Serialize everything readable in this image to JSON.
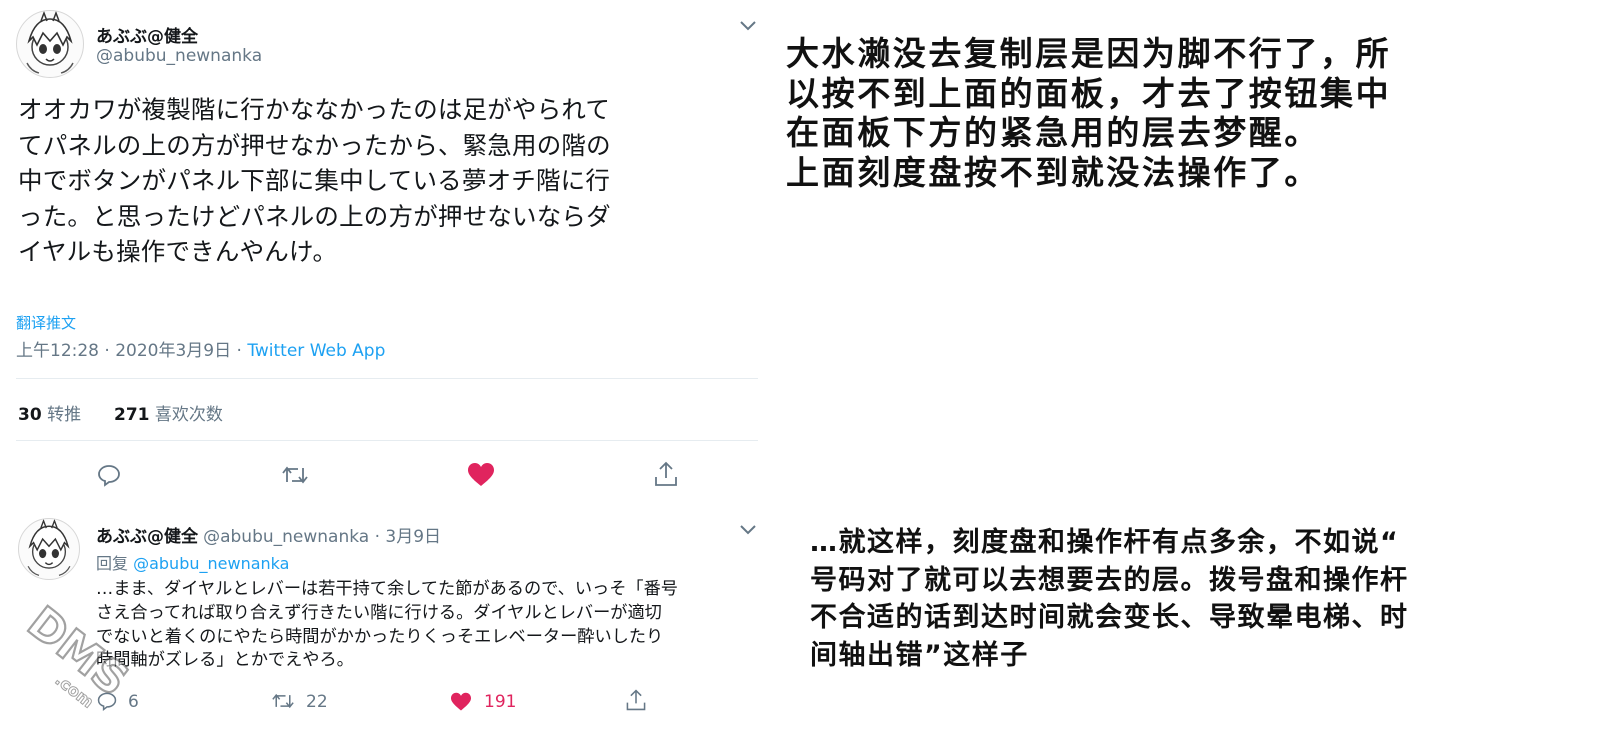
{
  "tweet1": {
    "display_name": "あぶぶ@健全",
    "handle": "@abubu_newnanka",
    "text_lines": [
      "オオカワが複製階に行かななかったのは足がやられて",
      "てパネルの上の方が押せなかったから、緊急用の階の",
      "中でボタンがパネル下部に集中している夢オチ階に行",
      "った。と思ったけどパネルの上の方が押せないならダ",
      "イヤルも操作できんやんけ。"
    ],
    "translate_label": "翻译推文",
    "timestamp": "上午12:28 · 2020年3月9日 · ",
    "source_app": "Twitter Web App",
    "retweet_count": "30",
    "retweet_label": " 转推",
    "like_count": "271",
    "like_label": " 喜欢次数",
    "icons": [
      "chevron-down-icon",
      "reply-icon",
      "retweet-icon",
      "heart-icon",
      "share-icon"
    ],
    "like_color": "#e0245e",
    "link_color": "#1da1f2"
  },
  "tweet2": {
    "display_name": "あぶぶ@健全",
    "handle_time": "@abubu_newnanka · 3月9日",
    "reply_prefix": "回复 ",
    "reply_target": "@abubu_newnanka",
    "text_lines": [
      "…まま、ダイヤルとレバーは若干持て余してた節があるので、いっそ「番号",
      "さえ合ってれば取り合えず行きたい階に行ける。ダイヤルとレバーが適切",
      "でないと着くのにやたら時間がかかったりくっそエレベーター酔いしたり",
      "時間軸がズレる」とかでえやろ。"
    ],
    "reply_count": "6",
    "retweet_count": "22",
    "like_count": "191"
  },
  "translation1": {
    "lines": [
      "大水濑没去复制层是因为脚不行了，所",
      "以按不到上面的面板，才去了按钮集中",
      "在面板下方的紧急用的层去梦醒。",
      "上面刻度盘按不到就没法操作了。"
    ]
  },
  "translation2": {
    "lines": [
      "…就这样，刻度盘和操作杆有点多余，不如说“",
      "号码对了就可以去想要去的层。拨号盘和操作杆",
      "不合适的话到达时间就会变长、导致晕电梯、时",
      "间轴出错”这样子"
    ]
  },
  "watermark": {
    "text": "DMS",
    "suffix": ".com"
  }
}
